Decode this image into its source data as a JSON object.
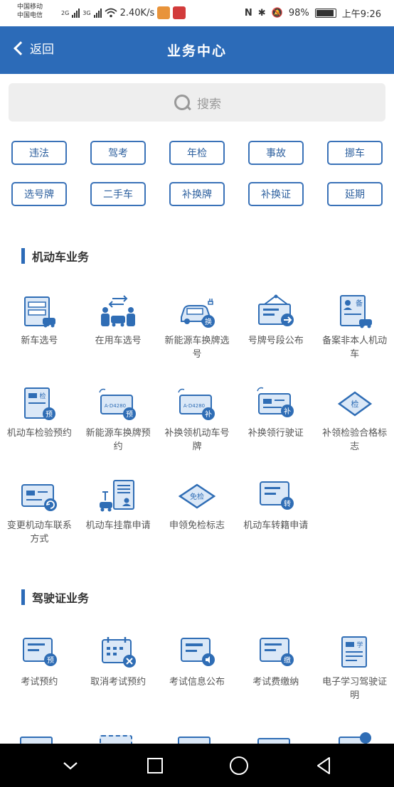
{
  "status_bar": {
    "carrier1": "中国移动",
    "carrier2": "中国电信",
    "net1": "2G",
    "net2": "3G",
    "speed": "2.40K/s",
    "battery": "98%",
    "time": "上午9:26"
  },
  "nav": {
    "back_label": "返回",
    "title": "业务中心"
  },
  "search": {
    "placeholder": "搜索"
  },
  "tags": [
    "违法",
    "驾考",
    "年检",
    "事故",
    "挪车",
    "选号牌",
    "二手车",
    "补换牌",
    "补换证",
    "延期"
  ],
  "sections": [
    {
      "title": "机动车业务",
      "items": [
        {
          "label": "新车选号",
          "icon": "new-car-plate-icon"
        },
        {
          "label": "在用车选号",
          "icon": "used-car-plate-icon"
        },
        {
          "label": "新能源车换牌选号",
          "icon": "ev-plate-change-icon"
        },
        {
          "label": "号牌号段公布",
          "icon": "plate-range-announce-icon"
        },
        {
          "label": "备案非本人机动车",
          "icon": "record-vehicle-icon"
        },
        {
          "label": "机动车检验预约",
          "icon": "inspection-booking-icon"
        },
        {
          "label": "新能源车换牌预约",
          "icon": "ev-plate-booking-icon"
        },
        {
          "label": "补换领机动车号牌",
          "icon": "replace-plate-icon"
        },
        {
          "label": "补换领行驶证",
          "icon": "replace-license-icon"
        },
        {
          "label": "补领检验合格标志",
          "icon": "inspection-mark-icon"
        },
        {
          "label": "变更机动车联系方式",
          "icon": "change-contact-icon"
        },
        {
          "label": "机动车挂靠申请",
          "icon": "affiliation-apply-icon"
        },
        {
          "label": "申领免检标志",
          "icon": "exempt-mark-icon"
        },
        {
          "label": "机动车转籍申请",
          "icon": "transfer-apply-icon"
        }
      ]
    },
    {
      "title": "驾驶证业务",
      "items": [
        {
          "label": "考试预约",
          "icon": "exam-booking-icon"
        },
        {
          "label": "取消考试预约",
          "icon": "cancel-exam-icon"
        },
        {
          "label": "考试信息公布",
          "icon": "exam-info-icon"
        },
        {
          "label": "考试费缴纳",
          "icon": "exam-fee-icon"
        },
        {
          "label": "电子学习驾驶证明",
          "icon": "e-learning-cert-icon"
        }
      ]
    }
  ],
  "badges": {
    "huan": "换",
    "jian": "检",
    "yu": "预",
    "bu": "补",
    "mianjian": "免检",
    "zhuan": "转",
    "jiao": "缴",
    "xue": "学",
    "bei": "备",
    "plate": "A·D4280"
  },
  "colors": {
    "primary": "#2c6bb8",
    "icon_blue": "#2f6db5",
    "icon_light": "#dbe8f7"
  }
}
